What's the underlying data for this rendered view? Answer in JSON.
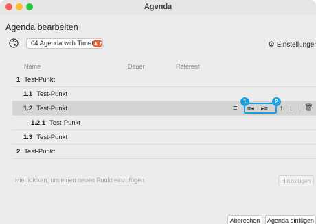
{
  "window": {
    "title": "Agenda"
  },
  "heading": "Agenda bearbeiten",
  "toolbar": {
    "preset_value": "04 Agenda with Timet...",
    "settings_label": "Einstellungen",
    "palette_icon": "palette-icon",
    "settings_icon": "gear-icon"
  },
  "columns": {
    "name": "Name",
    "duration": "Dauer",
    "presenter": "Referent"
  },
  "rows": [
    {
      "number": "1",
      "title": "Test-Punkt",
      "level": 0,
      "selected": false
    },
    {
      "number": "1.1",
      "title": "Test-Punkt",
      "level": 1,
      "selected": false
    },
    {
      "number": "1.2",
      "title": "Test-Punkt",
      "level": 1,
      "selected": true
    },
    {
      "number": "1.2.1",
      "title": "Test-Punkt",
      "level": 2,
      "selected": false
    },
    {
      "number": "1.3",
      "title": "Test-Punkt",
      "level": 1,
      "selected": false
    },
    {
      "number": "2",
      "title": "Test-Punkt",
      "level": 0,
      "selected": false
    }
  ],
  "row_actions": {
    "menu_icon": "≡",
    "outdent_icon": "≡◂",
    "indent_icon": "▸≡",
    "up_icon": "↑",
    "down_icon": "↓",
    "delete_icon": "🗑"
  },
  "callouts": {
    "first": "1",
    "second": "2"
  },
  "new_item_placeholder": "Hier klicken, um einen neuen Punkt einzufügen",
  "add_button": "Hinzufügen",
  "footer": {
    "cancel": "Abbrechen",
    "insert": "Agenda einfügen"
  },
  "colors": {
    "accent": "#1aa0de",
    "select_arrow": "#e2663a",
    "selected_row": "#d4d4d4"
  }
}
